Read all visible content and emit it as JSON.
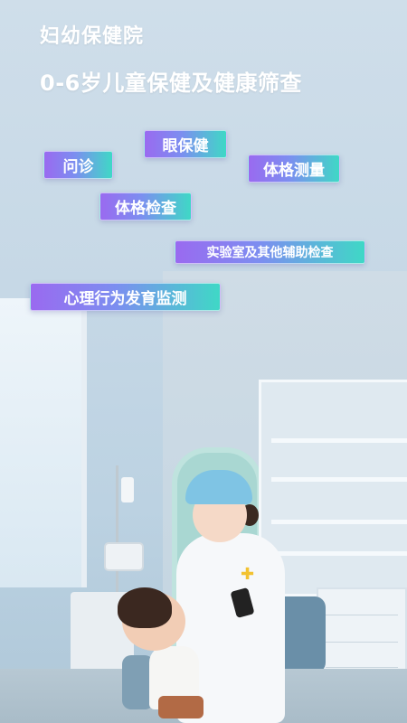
{
  "header": {
    "title": "妇幼保健院",
    "subtitle": "0-6岁儿童保健及健康筛查"
  },
  "tags": {
    "consultation": "问诊",
    "eye_care": "眼保健",
    "body_measurement": "体格测量",
    "physical_exam": "体格检查",
    "lab_tests": "实验室及其他辅助检查",
    "behavior_monitoring": "心理行为发育监测"
  },
  "colors": {
    "tag_gradient_start": "#9a6af0",
    "tag_gradient_end": "#3fd8c6",
    "title_text": "#ffffff"
  },
  "icons": {
    "badge": "plus-cross-icon"
  }
}
